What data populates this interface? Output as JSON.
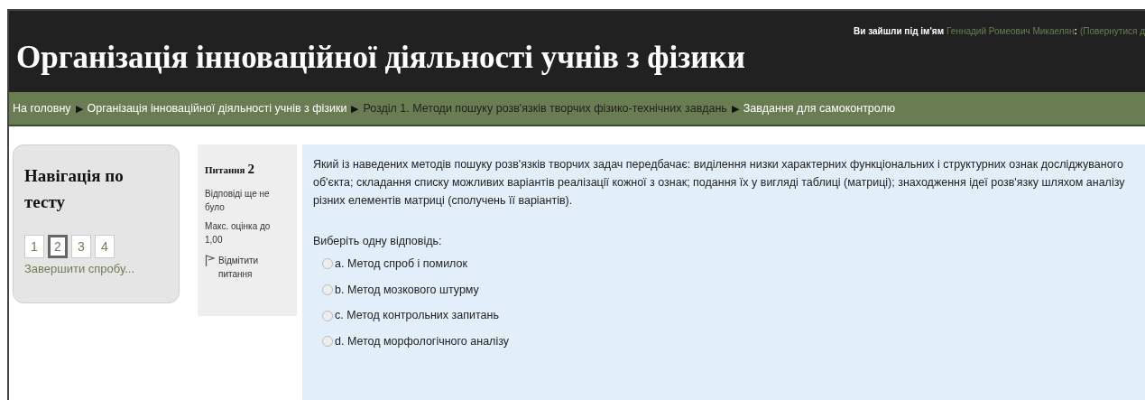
{
  "header": {
    "title": "Організація інноваційної діяльності учнів з фізики",
    "login_info": {
      "label": "Ви зайшли під ім'ям",
      "user_name": "Геннадий Ромеович Микаелян",
      "separator": ":",
      "logout_link": "(Повернутися д"
    }
  },
  "breadcrumb": [
    {
      "label": "На головну",
      "color": "#ffffff"
    },
    {
      "label": "Організація інноваційної діяльності учнів з фізики",
      "color": "#ffffff"
    },
    {
      "label": "Розділ 1. Методи пошуку розв'язків творчих фізико-технічних завдань",
      "color": "#1f1f1f"
    },
    {
      "label": "Завдання для самоконтролю",
      "color": "#ffffff"
    }
  ],
  "breadcrumb_separator": "▶",
  "quiz_navigation": {
    "title": "Навігація по тесту",
    "buttons": [
      {
        "label": "1",
        "selected": false
      },
      {
        "label": "2",
        "selected": true
      },
      {
        "label": "3",
        "selected": false
      },
      {
        "label": "4",
        "selected": false
      }
    ],
    "finish_link": "Завершити спробу..."
  },
  "question_info": {
    "label": "Питання",
    "number": "2",
    "state": "Відповіді ще не було",
    "max_grade": "Макс. оцінка до 1,00",
    "flag_link": "Відмітити питання"
  },
  "question": {
    "text": "Який із наведених методів пошуку розв'язків творчих задач передбачає: виділення низки характерних функціональних і структурних ознак досліджуваного об'єкта; складання списку можливих варіантів реалізації кожної з ознак; подання їх у вигляді таблиці (матриці); знаходження ідеї розв'язку шляхом аналізу різних елементів матриці (сполучень її варіантів).",
    "prompt": "Виберіть одну відповідь:",
    "options": [
      {
        "label": "a. Метод спроб і помилок",
        "selected": false
      },
      {
        "label": "b. Метод мозкового штурму",
        "selected": false
      },
      {
        "label": "c. Метод контрольних запитань",
        "selected": false
      },
      {
        "label": "d. Метод морфологічного аналізу",
        "selected": false
      }
    ]
  }
}
